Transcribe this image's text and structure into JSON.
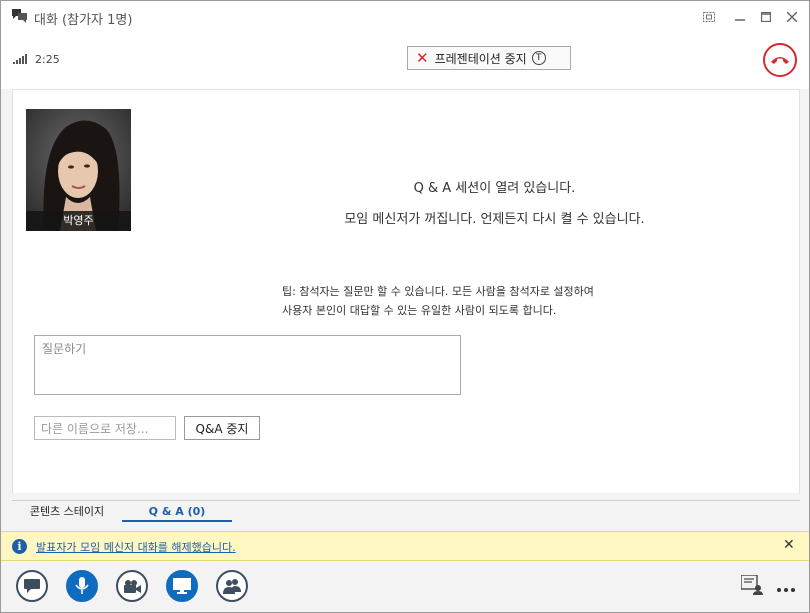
{
  "window": {
    "title": "대화 (참가자 1명)"
  },
  "callbar": {
    "duration": "2:25",
    "stop_presentation_label": "프레젠테이션 중지",
    "stop_presentation_key": "T"
  },
  "stage": {
    "participant_name": "박영주",
    "qa_open_message": "Q & A 세션이 열려 있습니다.",
    "messenger_off_message": "모임 메신저가 꺼집니다. 언제든지 다시 켤 수 있습니다.",
    "tip_line1": "팁: 참석자는 질문만 할 수 있습니다. 모든 사람을 참석자로 설정하여",
    "tip_line2": "사용자 본인이 대답할 수 있는 유일한 사람이 되도록 합니다.",
    "question_placeholder": "질문하기",
    "save_as_label": "다른 이름으로 저장...",
    "stop_qa_label": "Q&A 중지"
  },
  "tabs": [
    {
      "label": "콘텐츠 스테이지"
    },
    {
      "label": "Q & A (0)"
    }
  ],
  "infobar": {
    "message": "발표자가 모임 메신저 대화를 해제했습니다."
  },
  "colors": {
    "accent": "#0f6bbf",
    "hangup": "#d9282f",
    "info_bg": "#fff7c2"
  }
}
